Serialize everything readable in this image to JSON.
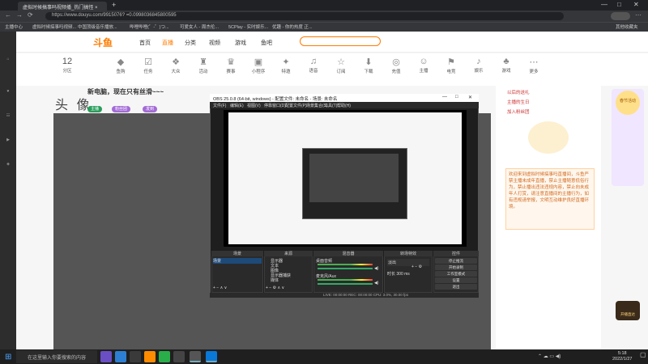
{
  "browser": {
    "tabs": [
      {
        "label": "虚拟时候搞事吗视频播_热门搞怪 ×"
      },
      {
        "label": "+"
      }
    ],
    "url": "https://www.douyu.com/9915076? =0.0998036845800595",
    "bookmarks": [
      "主播中心",
      "虚拟时候搞事吗视频...",
      "中国顶级音乐播放...",
      "哔哩哔哩(゜-゜)つ...",
      "可爱女人 - 周杰伦...",
      "5CPlay - 实时娱乐...",
      "优趣 - 你的热度 正..."
    ],
    "bookmark_right": "其他收藏夹"
  },
  "site": {
    "logo": "斗鱼",
    "nav": [
      "首页",
      "直播",
      "分类",
      "视频",
      "游戏",
      "鱼吧"
    ],
    "categories": [
      "12",
      "分区",
      "鱼购",
      "任务",
      "大众",
      "活动",
      "赛事",
      "小程序",
      "特邀",
      "语音",
      "订阅",
      "下载",
      "充值",
      "主播",
      "电竞",
      "娱乐",
      "游戏",
      "更多"
    ],
    "stream_title": "新电脑，现在只有丝滑~~~",
    "avatar_text": "头 像",
    "badges": [
      "主播",
      "粉丝团",
      "发到"
    ],
    "right_panel": {
      "lines": [
        "以后的送礼",
        "主播的生日",
        "加入粉丝团"
      ],
      "notice": "欢迎来到虚拟时候搞事吗直播间，斗鱼严禁主播未成年直播，禁止主播随意低俗行为，禁止播出违法违规内容，禁止向未成年人打赏，请注意直播间的主播行为，如有违规请举报，文明互动维护良好直播环境。"
    },
    "promo": "春节活动",
    "live_badge": "开播直达"
  },
  "obs": {
    "title": "OBS 25.0.8 (64-bit, windows) - 配置文件: 未命名 - 场景: 未命名",
    "menu": [
      "文件(F)",
      "编辑(E)",
      "视图(V)",
      "停靠窗口(D)",
      "配置文件(P)",
      "场景集合(S)",
      "工具(T)",
      "帮助(H)"
    ],
    "docks": {
      "scenes": {
        "title": "场景",
        "items": [
          "场景"
        ]
      },
      "sources": {
        "title": "来源",
        "items": [
          "显示器",
          "文本",
          "图像",
          "显示器捕获",
          "媒体"
        ]
      },
      "mixer": {
        "title": "混音器",
        "items": [
          "桌面音频",
          "麦克风/Aux"
        ]
      },
      "transitions": {
        "title": "转场特效",
        "items": [
          "淡出",
          "时长  300 ms"
        ]
      },
      "controls": {
        "title": "控件",
        "buttons": [
          "停止推流",
          "开始录制",
          "工作室模式",
          "设置",
          "退出"
        ]
      }
    },
    "status": "LIVE: 00:00:00   REC: 00:00:00   CPU: 3.0%, 30.00 fps"
  },
  "taskbar": {
    "search_placeholder": "在这里输入你要搜索的内容",
    "time": "5:18",
    "date": "2022/1/27"
  }
}
